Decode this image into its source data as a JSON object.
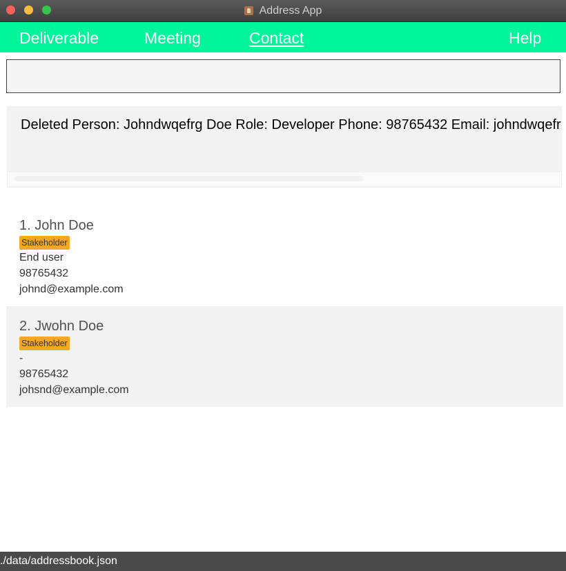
{
  "window": {
    "title": "Address App"
  },
  "menu": {
    "items": [
      {
        "label": "Deliverable"
      },
      {
        "label": "Meeting"
      },
      {
        "label": "Contact"
      }
    ],
    "help": "Help"
  },
  "command": {
    "value": ""
  },
  "result": {
    "text": "Deleted Person: Johndwqefrg Doe Role: Developer Phone: 98765432 Email: johndwqefrg@example.com"
  },
  "persons": [
    {
      "name": "1.  John Doe",
      "tag": "Stakeholder",
      "role": "End user",
      "phone": "98765432",
      "email": "johnd@example.com"
    },
    {
      "name": "2.  Jwohn Doe",
      "tag": "Stakeholder",
      "role": "-",
      "phone": "98765432",
      "email": "johsnd@example.com"
    }
  ],
  "status": {
    "path": "./data/addressbook.json"
  },
  "colors": {
    "menu_bar": "#00f59b",
    "tag": "#f5a623",
    "status_bar": "#4a4a4a"
  }
}
